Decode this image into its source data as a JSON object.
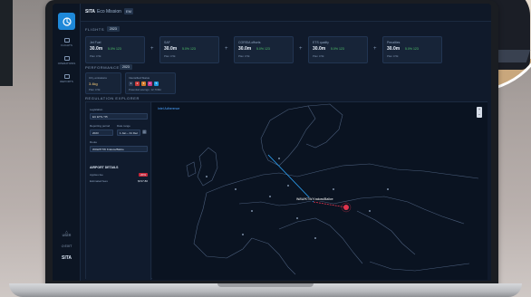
{
  "header": {
    "brand": "SITA",
    "app": "Eco Mission",
    "tag": "EM"
  },
  "sidebar": {
    "items": [
      {
        "label": "FLIGHTS"
      },
      {
        "label": "OPERATIONS"
      },
      {
        "label": "REPORTS"
      }
    ],
    "bottom": [
      {
        "label": "USER"
      },
      {
        "label": "EXIT"
      },
      {
        "label": "SITA"
      }
    ]
  },
  "flights": {
    "title": "FLIGHTS",
    "pill": "2023",
    "kpis": [
      {
        "label": "Jet Fuel",
        "value": "30.0m",
        "delta": "5.0% 123",
        "sub": "Plan 3.5k"
      },
      {
        "label": "SAF",
        "value": "30.0m",
        "delta": "5.0% 123",
        "sub": "Plan 3.5k"
      },
      {
        "label": "CORSIA offsets",
        "value": "30.0m",
        "delta": "5.0% 123",
        "sub": "Plan 3.5k"
      },
      {
        "label": "ETS quality",
        "value": "30.0m",
        "delta": "5.0% 123",
        "sub": "Plan 3.5k"
      },
      {
        "label": "Penalties",
        "value": "30.0m",
        "delta": "5.0% 123",
        "sub": "Plan 3.5k"
      }
    ]
  },
  "performance": {
    "title": "PERFORMANCE",
    "pill": "2023",
    "cards": [
      {
        "label": "CO₂ emissions",
        "value": "3.4kg",
        "sub": "Plan 3.5k"
      },
      {
        "label": "Intensified Status",
        "sub": "Potential savings: 12,700kt"
      }
    ],
    "squares": [
      "1",
      "2",
      "3",
      "4",
      "5"
    ]
  },
  "explorer": {
    "title": "REGULATION EXPLORER",
    "map_label": "Intel Adherence",
    "pin_label": "WAW/KTW Krakow/Balice",
    "filters": {
      "regulation_label": "Legislation",
      "regulation_value": "EU ETS / 55",
      "reporting_label": "Reporting period",
      "date_label": "Date range",
      "reporting_value": "2023",
      "date_value": "1 Jan – 31 Dec",
      "route_label": "Route",
      "route_value": "WAW/KTW Krakow/Balice"
    },
    "details": {
      "title": "AIRPORT DETAILS",
      "rows": [
        {
          "label": "Applies fee",
          "value": "20%"
        },
        {
          "label": "Estimated fees",
          "value": "$727.80"
        }
      ]
    }
  }
}
